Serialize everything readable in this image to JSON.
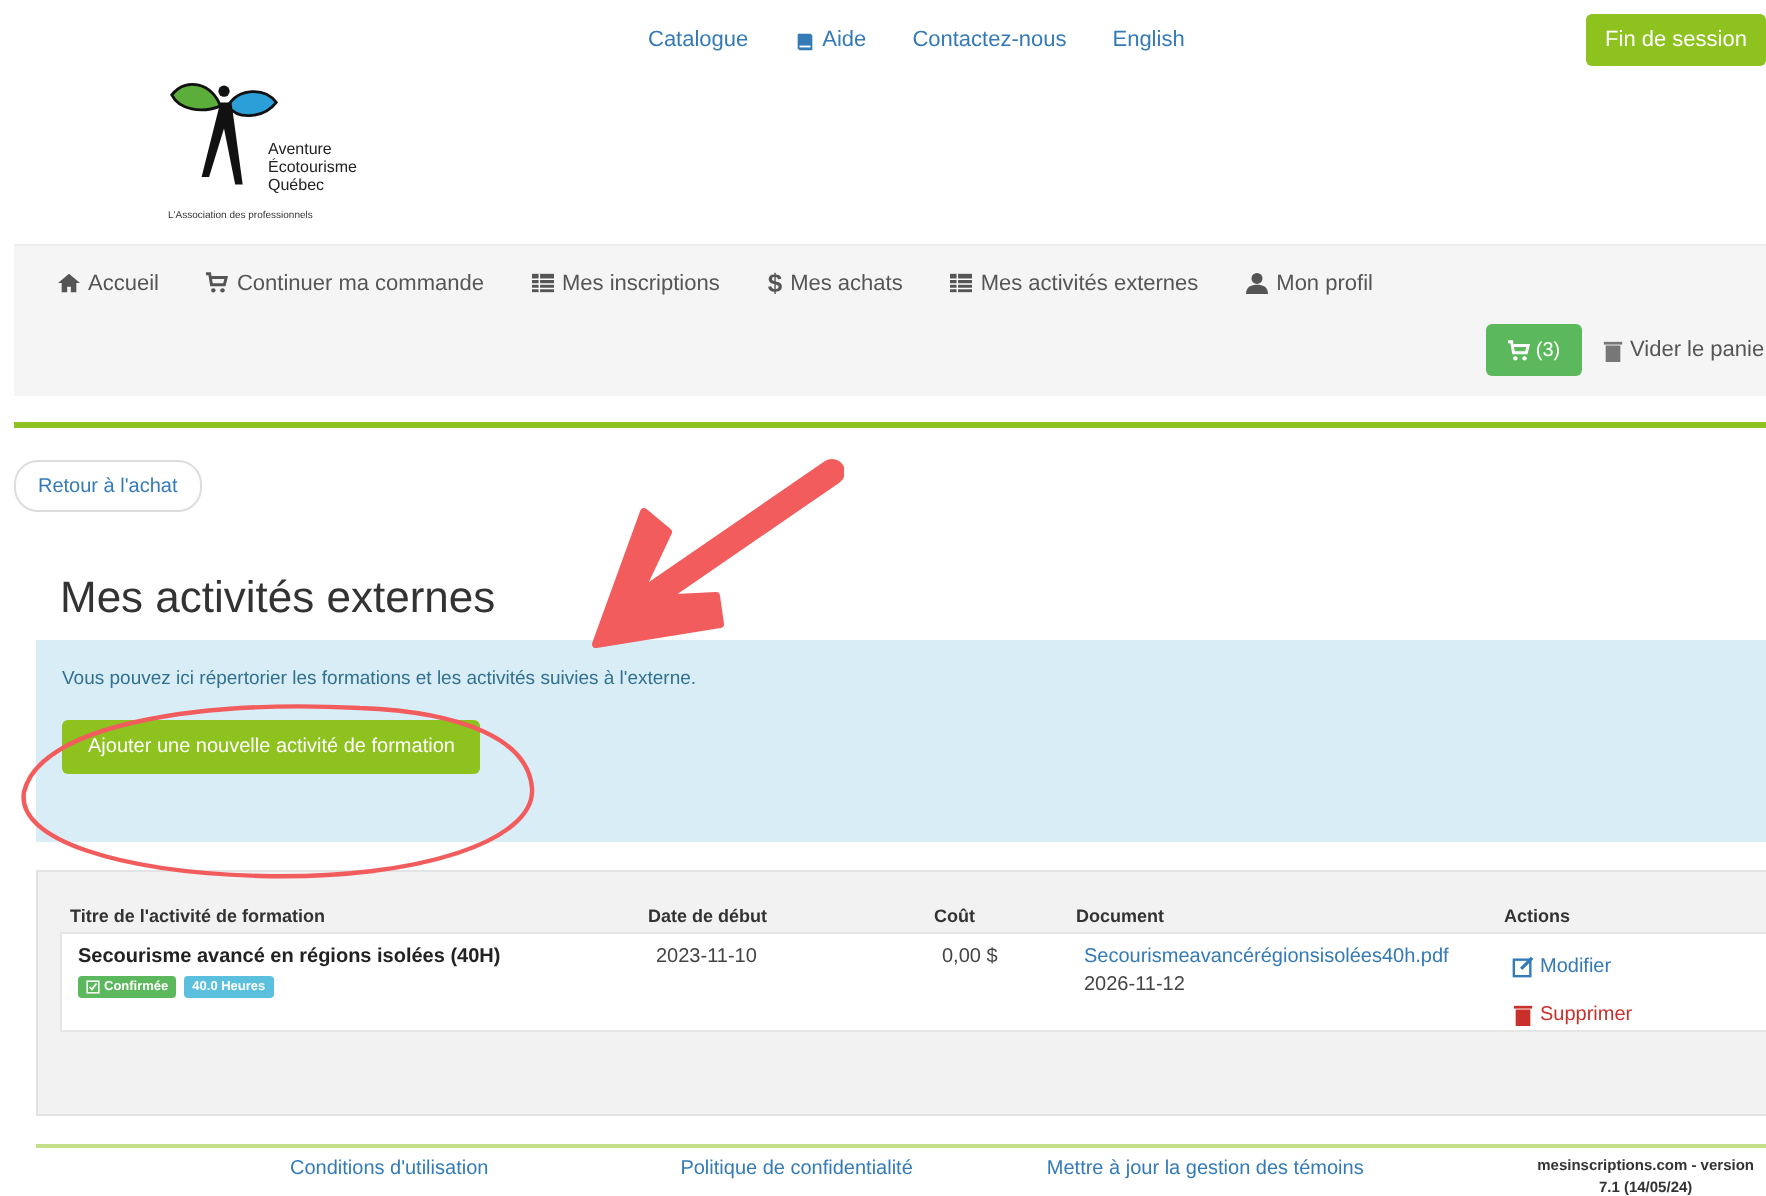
{
  "top_links": [
    {
      "label": "Catalogue"
    },
    {
      "label": "Aide"
    },
    {
      "label": "Contactez-nous"
    },
    {
      "label": "English"
    }
  ],
  "logout_button": "Fin de session",
  "logo": {
    "lines": [
      "Aventure",
      "Écotourisme",
      "Québec"
    ],
    "tagline": "L'Association des professionnels"
  },
  "nav": {
    "items": [
      {
        "label": "Accueil"
      },
      {
        "label": "Continuer ma commande"
      },
      {
        "label": "Mes inscriptions"
      },
      {
        "glyph": "$",
        "label": "Mes achats"
      },
      {
        "label": "Mes activités externes"
      },
      {
        "label": "Mon profil"
      }
    ],
    "cart_button": "(3)",
    "empty_cart": "Vider le panie"
  },
  "back_button": "Retour à l'achat",
  "heading": "Mes activités externes",
  "info": {
    "text": "Vous pouvez ici répertorier les formations et les activités suivies à l'externe.",
    "add_button": "Ajouter une nouvelle activité de formation"
  },
  "table": {
    "columns": [
      "Titre de l'activité de formation",
      "Date de début",
      "Coût",
      "Document",
      "Actions"
    ],
    "rows": [
      {
        "title": "Secourisme avancé en régions isolées (40H)",
        "badges": [
          {
            "kind": "status",
            "label": "Confirmée"
          },
          {
            "kind": "hours",
            "label": "40.0 Heures"
          }
        ],
        "start_date": "2023-11-10",
        "cost": "0,00 $",
        "document": "Secourismeavancérégionsisolées40h.pdf",
        "document_date": "2026-11-12",
        "actions": [
          {
            "kind": "edit",
            "label": "Modifier"
          },
          {
            "kind": "delete",
            "label": "Supprimer"
          }
        ]
      }
    ]
  },
  "footer": {
    "links": [
      "Conditions d'utilisation",
      "Politique de confidentialité",
      "Mettre à jour la gestion des témoins"
    ],
    "version": [
      "mesinscriptions.com - version",
      "7.1 (14/05/24)"
    ]
  }
}
